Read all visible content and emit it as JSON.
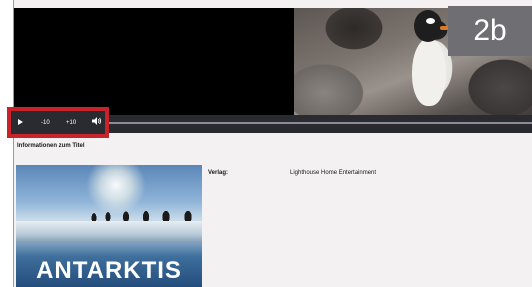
{
  "badge": "2b",
  "player": {
    "play_label": "▶",
    "rewind_label": "-10",
    "forward_label": "+10",
    "icons": [
      "play-icon",
      "volume-icon"
    ]
  },
  "info": {
    "section_title": "Informationen zum Titel",
    "publisher_label": "Verlag:",
    "publisher_value": "Lighthouse Home Entertainment"
  },
  "cover": {
    "title": "ANTARKTIS"
  },
  "colors": {
    "highlight": "#c8232b",
    "controls_bg": "#2a2b31",
    "badge_bg": "#6f6f73"
  }
}
